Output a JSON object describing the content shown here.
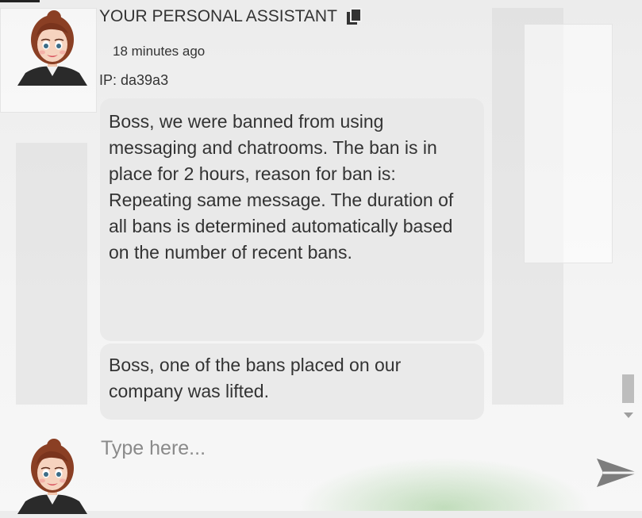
{
  "message": {
    "sender": "YOUR PERSONAL ASSISTANT",
    "time": "18 minutes ago",
    "ip": "IP: da39a3",
    "bubbles": [
      "Boss, we were banned from using messaging and chatrooms. The ban is in place for 2 hours, reason for ban is: Repeating same message. The duration of all bans is determined automatically based on the number of recent bans.",
      "Boss, one of the bans placed on our company was lifted."
    ]
  },
  "composer": {
    "placeholder": "Type here..."
  },
  "icons": {
    "copy": "copy-icon",
    "send": "send-icon",
    "scroll_down": "chevron-down-icon"
  },
  "colors": {
    "bubble": "#e8e8e8",
    "text": "#333333",
    "send": "#7d7d7d",
    "scroll_thumb": "#bdbdbd"
  }
}
